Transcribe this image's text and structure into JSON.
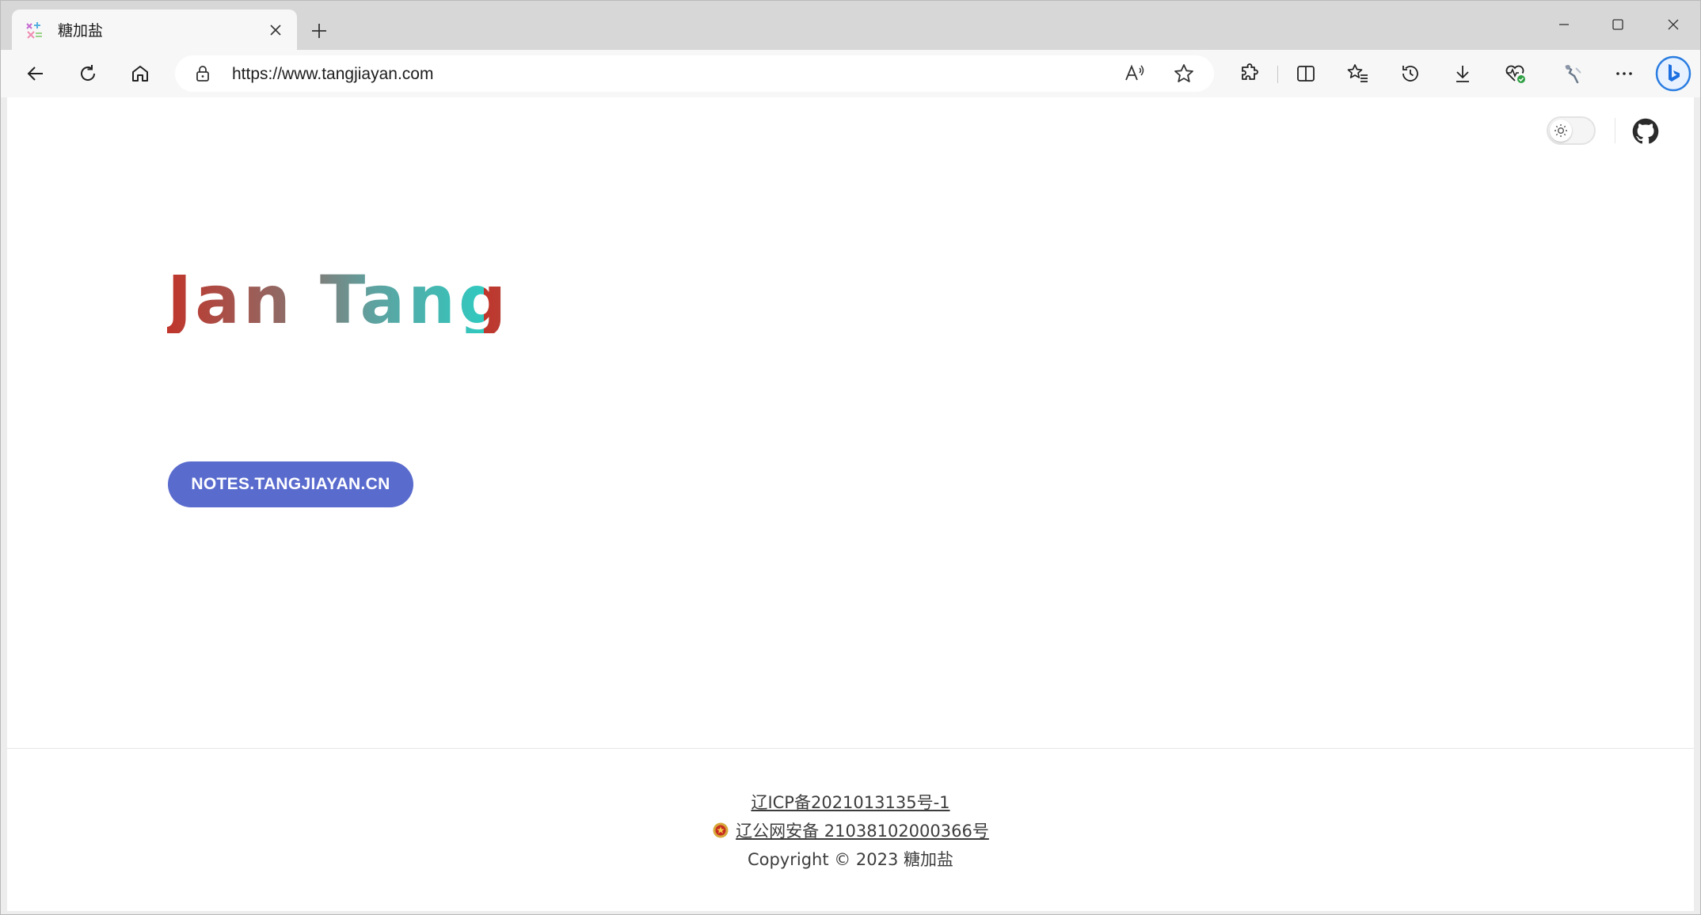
{
  "browser": {
    "tab": {
      "title": "糖加盐",
      "favicon": "site-favicon-icon"
    },
    "url": "https://www.tangjiayan.com",
    "icons": {
      "back": "arrow-left-icon",
      "refresh": "refresh-icon",
      "home": "home-icon",
      "lock": "lock-icon",
      "read_aloud": "read-aloud-icon",
      "favorite": "star-icon",
      "extensions": "puzzle-icon",
      "split": "split-screen-icon",
      "favorites": "favorites-list-icon",
      "history": "history-icon",
      "downloads": "download-icon",
      "performance": "heart-pulse-icon",
      "profile": "profile-icon",
      "more": "ellipsis-icon",
      "copilot": "bing-copilot-icon"
    }
  },
  "page": {
    "header": {
      "theme_toggle_icon": "sun-icon",
      "github_icon": "github-icon"
    },
    "logo": {
      "text": "Jan Tang"
    },
    "notes_button": {
      "label": "NOTES.TANGJIAYAN.CN"
    },
    "footer": {
      "icp": "辽ICP备2021013135号-1",
      "police": "辽公网安备 21038102000366号",
      "copyright": "Copyright © 2023 糖加盐"
    }
  },
  "colors": {
    "button": "#5a6bce",
    "logo_start": "#c0352b",
    "logo_end": "#30c9bf"
  }
}
